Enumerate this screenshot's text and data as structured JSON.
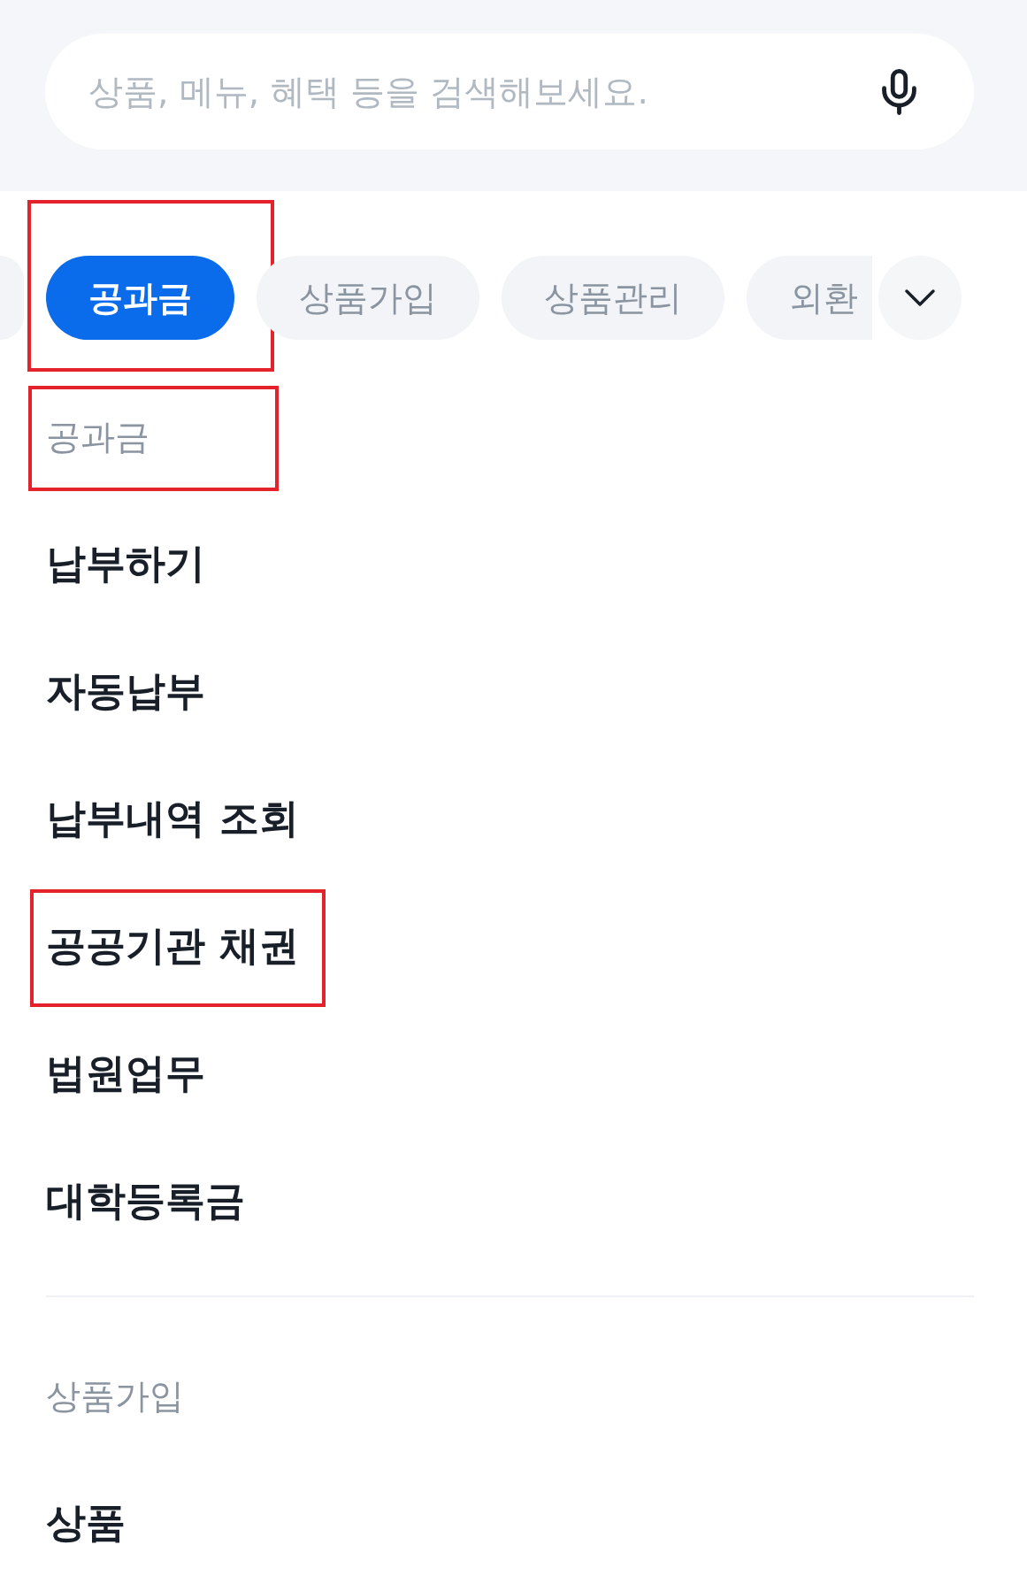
{
  "search": {
    "placeholder": "상품, 메뉴, 혜택 등을 검색해보세요."
  },
  "tabs": [
    {
      "label": "공과금",
      "selected": true,
      "highlighted": true
    },
    {
      "label": "상품가입",
      "selected": false,
      "highlighted": false
    },
    {
      "label": "상품관리",
      "selected": false,
      "highlighted": false
    },
    {
      "label": "외환",
      "selected": false,
      "highlighted": false
    }
  ],
  "sections": [
    {
      "heading": "공과금",
      "highlighted": true,
      "items": [
        {
          "label": "납부하기",
          "highlighted": false
        },
        {
          "label": "자동납부",
          "highlighted": false
        },
        {
          "label": "납부내역 조회",
          "highlighted": false
        },
        {
          "label": "공공기관 채권",
          "highlighted": true
        },
        {
          "label": "법원업무",
          "highlighted": false
        },
        {
          "label": "대학등록금",
          "highlighted": false
        }
      ]
    },
    {
      "heading": "상품가입",
      "highlighted": false,
      "items": [
        {
          "label": "상품",
          "highlighted": false
        }
      ]
    }
  ]
}
